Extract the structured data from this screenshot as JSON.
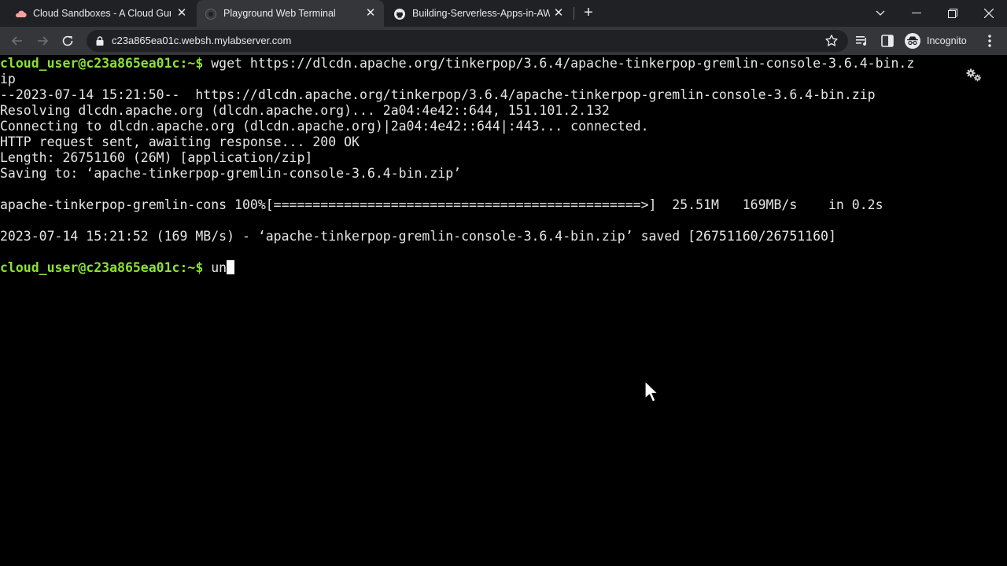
{
  "browser": {
    "tabs": [
      {
        "title": "Cloud Sandboxes - A Cloud Guru",
        "favicon": "cloud-icon",
        "active": false
      },
      {
        "title": "Playground Web Terminal",
        "favicon": "terminal-icon",
        "active": true
      },
      {
        "title": "Building-Serverless-Apps-in-AWS",
        "favicon": "github-icon",
        "active": false
      }
    ],
    "address_bar": {
      "url": "c23a865ea01c.websh.mylabserver.com"
    },
    "profile_label": "Incognito"
  },
  "terminal": {
    "prompt": "cloud_user@c23a865ea01c:~$",
    "prompt_color": "#8ae234",
    "command1": " wget https://dlcdn.apache.org/tinkerpop/3.6.4/apache-tinkerpop-gremlin-console-3.6.4-bin.z",
    "command1_wrap": "ip",
    "output": [
      "--2023-07-14 15:21:50--  https://dlcdn.apache.org/tinkerpop/3.6.4/apache-tinkerpop-gremlin-console-3.6.4-bin.zip",
      "Resolving dlcdn.apache.org (dlcdn.apache.org)... 2a04:4e42::644, 151.101.2.132",
      "Connecting to dlcdn.apache.org (dlcdn.apache.org)|2a04:4e42::644|:443... connected.",
      "HTTP request sent, awaiting response... 200 OK",
      "Length: 26751160 (26M) [application/zip]",
      "Saving to: ‘apache-tinkerpop-gremlin-console-3.6.4-bin.zip’",
      "apache-tinkerpop-gremlin-cons 100%[===============================================>]  25.51M   169MB/s    in 0.2s",
      "2023-07-14 15:21:52 (169 MB/s) - ‘apache-tinkerpop-gremlin-console-3.6.4-bin.zip’ saved [26751160/26751160]"
    ],
    "current_input": " un"
  }
}
